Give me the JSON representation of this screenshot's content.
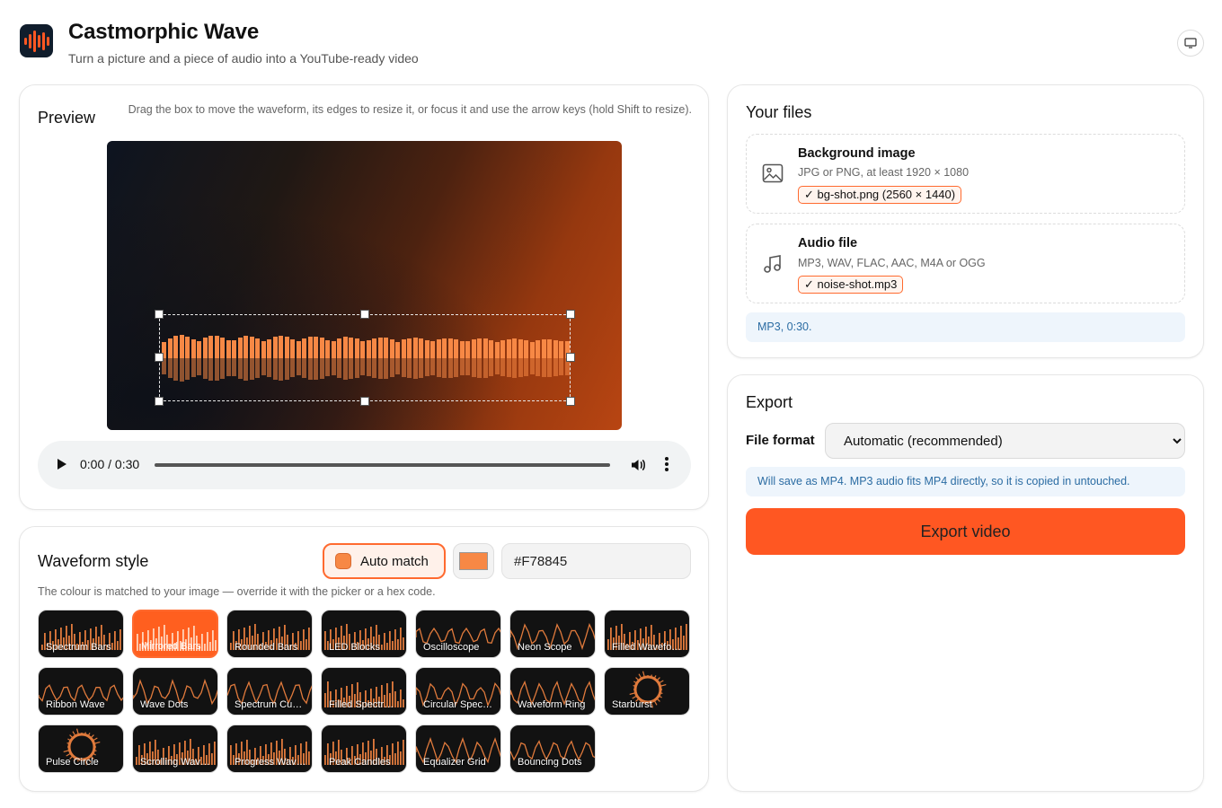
{
  "app": {
    "title": "Castmorphic Wave",
    "subtitle": "Turn a picture and a piece of audio into a YouTube-ready video",
    "logo_icon": "waveform-logo-icon",
    "display_icon": "monitor-icon"
  },
  "preview": {
    "title": "Preview",
    "hint": "Drag the box to move the waveform, its edges to resize it, or focus it and use the arrow keys (hold Shift to resize).",
    "player": {
      "time": "0:00 / 0:30",
      "progress": 0.0,
      "play_icon": "play-icon",
      "volume_icon": "volume-icon",
      "more_icon": "more-vert-icon"
    }
  },
  "waveform_style": {
    "title": "Waveform style",
    "auto_match_label": "Auto match",
    "hex_value": "#F78845",
    "hint": "The colour is matched to your image — override it with the picker or a hex code.",
    "selected": "Mirrored Bars",
    "styles": [
      "Spectrum Bars",
      "Mirrored Bars",
      "Rounded Bars",
      "LED Blocks",
      "Oscilloscope",
      "Neon Scope",
      "Filled Wavefo…",
      "Ribbon Wave",
      "Wave Dots",
      "Spectrum Cu…",
      "Filled Spectr…",
      "Circular Spec…",
      "Waveform Ring",
      "Starburst",
      "Pulse Circle",
      "Scrolling Wav…",
      "Progress Wav…",
      "Peak Candles",
      "Equalizer Grid",
      "Bouncing Dots"
    ]
  },
  "files": {
    "title": "Your files",
    "background": {
      "title": "Background image",
      "desc": "JPG or PNG, at least 1920 × 1080",
      "badge": "✓ bg-shot.png (2560 × 1440)",
      "icon": "image-icon"
    },
    "audio": {
      "title": "Audio file",
      "desc": "MP3, WAV, FLAC, AAC, M4A or OGG",
      "badge": "✓ noise-shot.mp3",
      "icon": "music-note-icon"
    },
    "info": "MP3, 0:30."
  },
  "export": {
    "title": "Export",
    "format_label": "File format",
    "format_value": "Automatic (recommended)",
    "info": "Will save as MP4. MP3 audio fits MP4 directly, so it is copied in untouched.",
    "button_label": "Export video"
  },
  "colors": {
    "accent": "#FF5722",
    "waveform": "#F78845",
    "info_bg": "#EEF5FC",
    "info_text": "#2B6CA3"
  }
}
